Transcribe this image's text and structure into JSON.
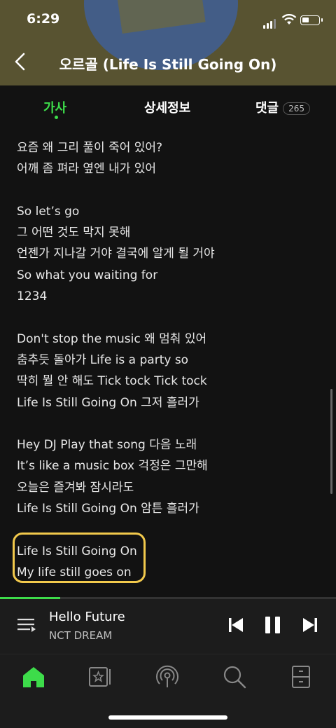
{
  "status_bar": {
    "time": "6:29"
  },
  "header": {
    "title": "오르골 (Life Is Still Going On)"
  },
  "tabs": [
    {
      "label": "가사",
      "active": true
    },
    {
      "label": "상세정보",
      "active": false
    },
    {
      "label": "댓글",
      "count": "265",
      "active": false
    }
  ],
  "lyrics": [
    "요즘 왜 그리 풀이 죽어 있어?",
    "어깨 좀 펴라 옆엔 내가 있어",
    "",
    "So let’s go",
    "그 어떤 것도 막지 못해",
    "언젠가 지나갈 거야 결국에 알게 될 거야",
    "So what you waiting for",
    "1234",
    "",
    "Don't stop the music 왜 멈춰 있어",
    "춤추듯 돌아가 Life is a party so",
    "딱히 뭘 안 해도 Tick tock Tick tock",
    "Life Is Still Going On 그저 흘러가",
    "",
    "Hey DJ Play that song 다음 노래",
    "It’s like a music box 걱정은 그만해",
    "오늘은 즐겨봐 잠시라도",
    "Life Is Still Going On 암튼 흘러가",
    "",
    "Life Is Still Going On",
    "My life still goes on"
  ],
  "player": {
    "track": "Hello Future",
    "artist": "NCT DREAM",
    "progress": 0.18
  },
  "colors": {
    "accent": "#3ddc4a",
    "highlight": "#f2c94c",
    "header_bg": "#585331"
  },
  "nav": [
    {
      "icon": "home-icon",
      "active": true
    },
    {
      "icon": "library-icon",
      "active": false
    },
    {
      "icon": "podcast-icon",
      "active": false
    },
    {
      "icon": "search-icon",
      "active": false
    },
    {
      "icon": "storage-icon",
      "active": false
    }
  ]
}
